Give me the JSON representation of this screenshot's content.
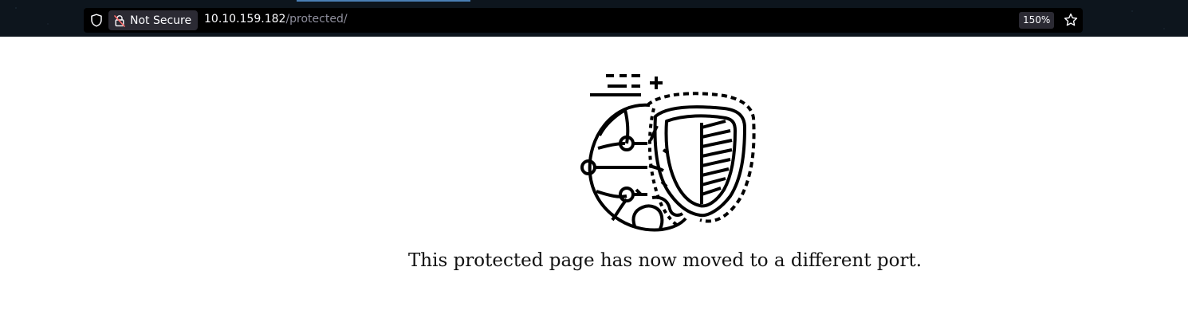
{
  "browser": {
    "security_label": "Not Secure",
    "url_host": "10.10.159.182",
    "url_path": "/protected/",
    "zoom_level": "150%",
    "icons": [
      "tracking-shield-icon",
      "insecure-lock-icon",
      "bookmark-star-icon"
    ],
    "warning_color": "#ff6b6b"
  },
  "page": {
    "illustration": "globe-shield-icon",
    "message": "This protected page has now moved to a different port."
  }
}
